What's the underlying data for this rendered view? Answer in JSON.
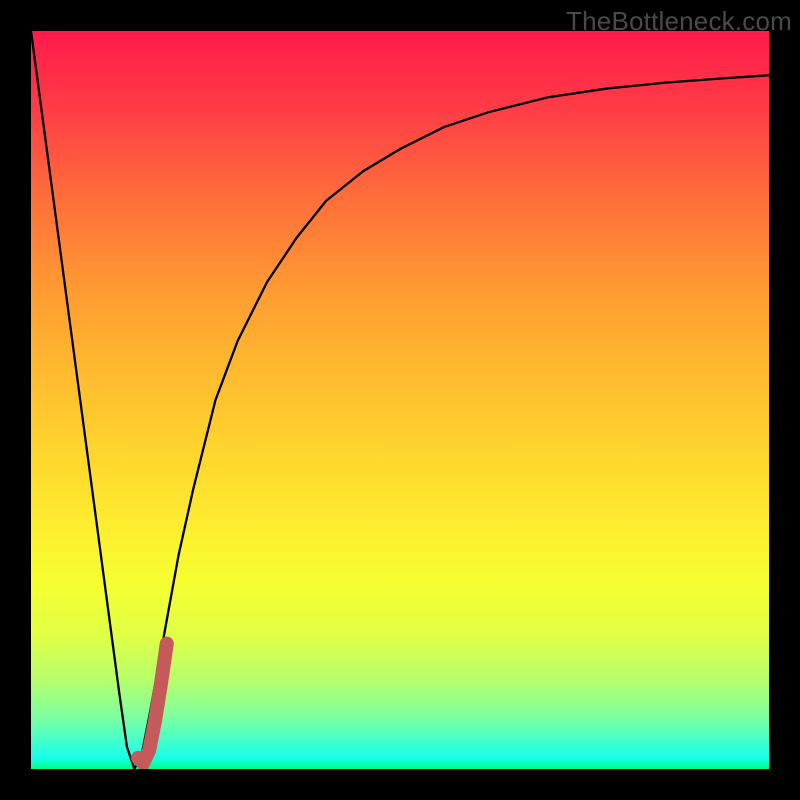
{
  "watermark": "TheBottleneck.com",
  "colors": {
    "frame": "#000000",
    "curve": "#000000",
    "marker": "#c45a5a",
    "gradient_top": "#ff1b4b",
    "gradient_bottom": "#00ff84"
  },
  "chart_data": {
    "type": "line",
    "title": "",
    "xlabel": "",
    "ylabel": "",
    "xlim": [
      0,
      100
    ],
    "ylim": [
      0,
      100
    ],
    "x": [
      0,
      2,
      4,
      6,
      8,
      10,
      12,
      13,
      14,
      15,
      16,
      18,
      20,
      22,
      25,
      28,
      32,
      36,
      40,
      45,
      50,
      56,
      62,
      70,
      78,
      86,
      94,
      100
    ],
    "y": [
      100,
      85,
      70,
      55,
      40,
      25,
      10,
      3,
      0,
      2,
      7,
      18,
      29,
      38,
      50,
      58,
      66,
      72,
      77,
      81,
      84,
      87,
      89,
      91,
      92.2,
      93,
      93.6,
      94
    ],
    "series": [
      {
        "name": "bottleneck-curve",
        "x": [
          0,
          2,
          4,
          6,
          8,
          10,
          12,
          13,
          14,
          15,
          16,
          18,
          20,
          22,
          25,
          28,
          32,
          36,
          40,
          45,
          50,
          56,
          62,
          70,
          78,
          86,
          94,
          100
        ],
        "y": [
          100,
          85,
          70,
          55,
          40,
          25,
          10,
          3,
          0,
          2,
          7,
          18,
          29,
          38,
          50,
          58,
          66,
          72,
          77,
          81,
          84,
          87,
          89,
          91,
          92.2,
          93,
          93.6,
          94
        ]
      }
    ],
    "marker": {
      "name": "highlight-hook",
      "x": [
        14.5,
        15.2,
        16.0,
        16.8,
        17.6,
        18.4
      ],
      "y": [
        1.5,
        0.8,
        2.5,
        6.5,
        11.5,
        17.0
      ]
    }
  }
}
